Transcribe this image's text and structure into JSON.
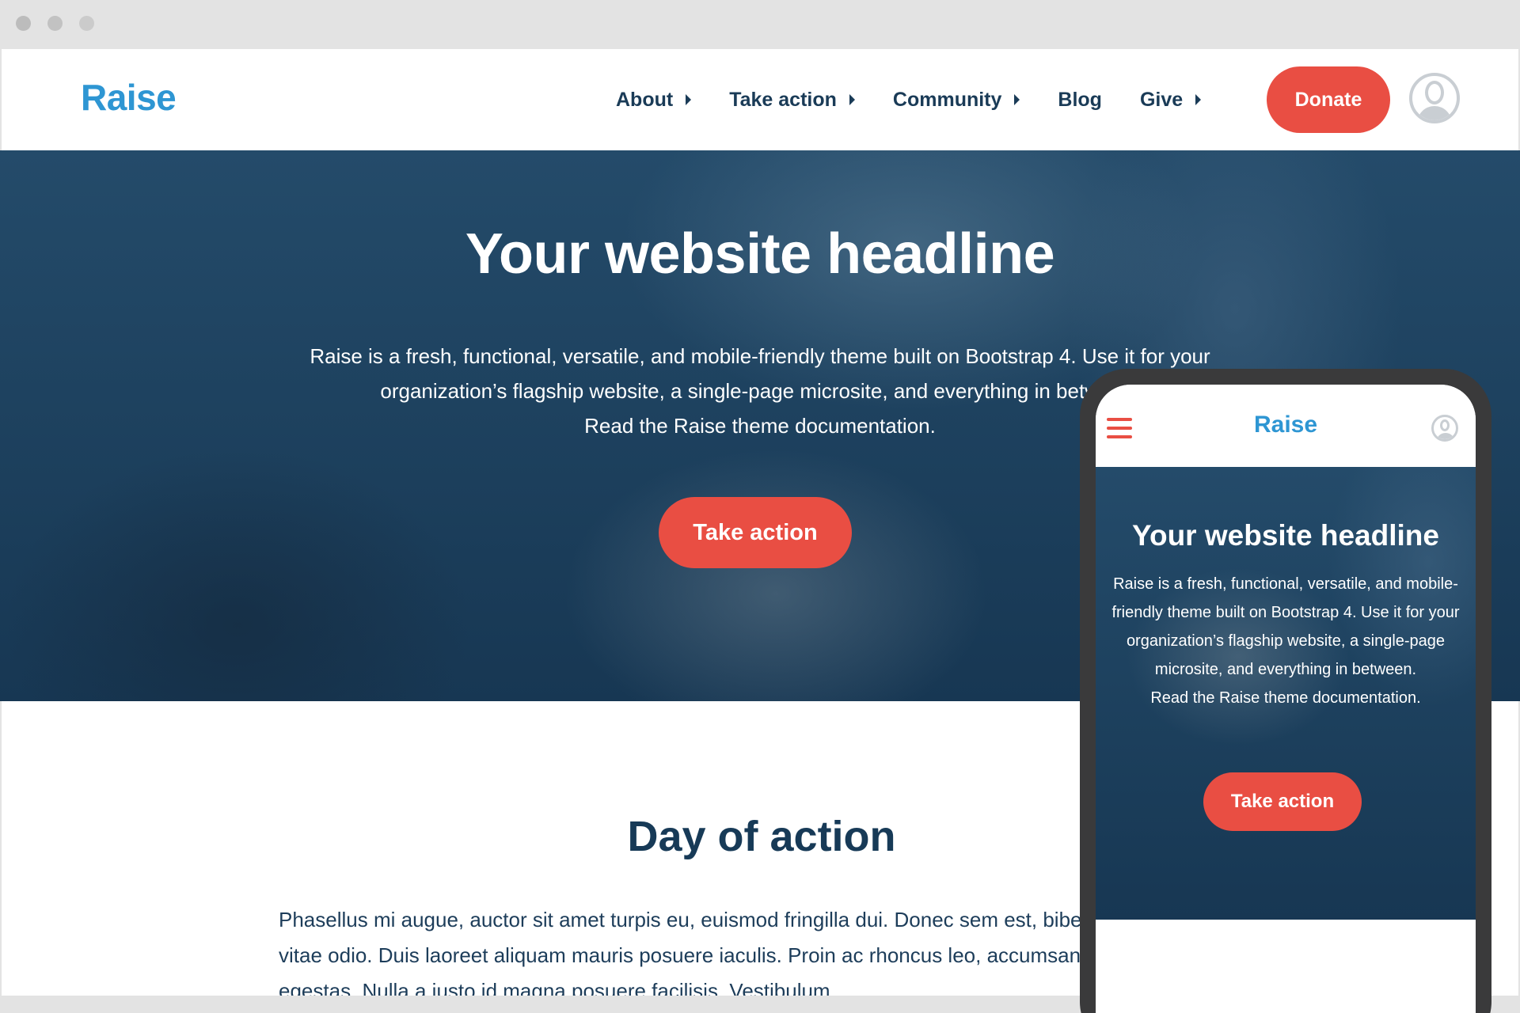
{
  "brand": {
    "name": "Raise",
    "accent_color": "#2e96d3",
    "button_color": "#e94e43",
    "heading_color": "#173a57"
  },
  "nav": {
    "items": [
      {
        "label": "About",
        "has_caret": true
      },
      {
        "label": "Take action",
        "has_caret": true
      },
      {
        "label": "Community",
        "has_caret": true
      },
      {
        "label": "Blog",
        "has_caret": false
      },
      {
        "label": "Give",
        "has_caret": true
      }
    ],
    "donate_label": "Donate",
    "avatar_icon": "user-avatar-icon"
  },
  "hero": {
    "headline": "Your website headline",
    "description": "Raise is a fresh, functional, versatile, and mobile-friendly theme built on Bootstrap 4. Use it for your organization’s flagship website, a single-page microsite, and everything in between.",
    "doc_link": "Read the Raise theme documentation.",
    "cta_label": "Take action"
  },
  "section": {
    "title": "Day of action",
    "body": "Phasellus mi augue, auctor sit amet turpis eu, euismod fringilla dui. Donec sem est, bibendum id, faucibus vitae odio. Duis laoreet aliquam mauris posuere iaculis. Proin ac rhoncus leo, accumsan vehicula nisi non egestas. Nulla a iusto id magna posuere facilisis. Vestibulum"
  },
  "mobile": {
    "logo": "Raise",
    "menu_icon": "hamburger-menu-icon",
    "headline": "Your website headline",
    "description": "Raise is a fresh, functional, versatile, and mobile-friendly theme built on Bootstrap 4. Use it for your organization’s flagship website, a single-page microsite, and everything in between.",
    "doc_link": "Read the Raise theme documentation.",
    "cta_label": "Take action"
  }
}
